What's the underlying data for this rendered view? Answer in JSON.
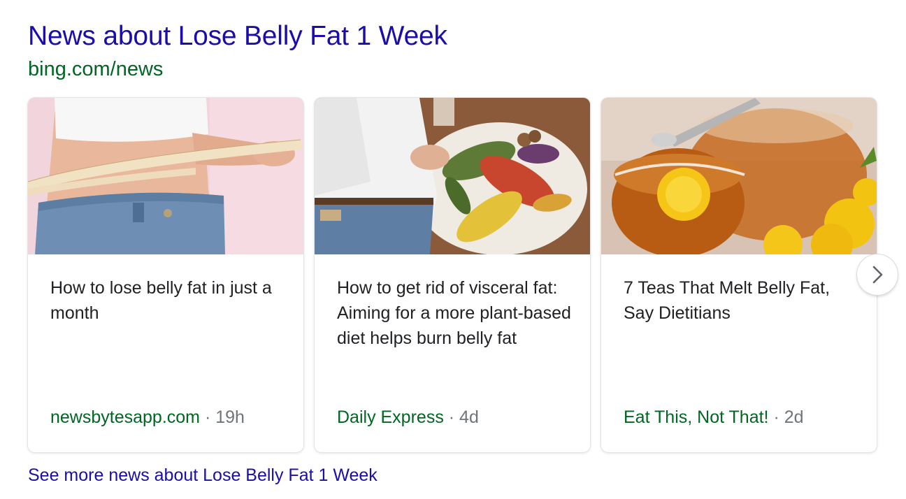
{
  "header": {
    "title": "News about Lose Belly Fat 1 Week",
    "url": "bing.com/news"
  },
  "cards": [
    {
      "headline": "How to lose belly fat in just a month",
      "publisher": "newsbytesapp.com",
      "separator": " · ",
      "age": "19h",
      "image": "woman measuring waist with tape measure"
    },
    {
      "headline": "How to get rid of visceral fat: Aiming for a more plant-based diet helps burn belly fat",
      "publisher": "Daily Express",
      "separator": " · ",
      "age": "4d",
      "image": "man holding belly beside platter of grilled vegetables"
    },
    {
      "headline": "7 Teas That Melt Belly Fat, Say Dietitians",
      "publisher": "Eat This, Not That!",
      "separator": " · ",
      "age": "2d",
      "image": "glass cups of tea with dandelion flowers"
    }
  ],
  "carousel": {
    "next_icon": "chevron-right-icon"
  },
  "footer": {
    "see_more": "See more news about Lose Belly Fat 1 Week"
  },
  "colors": {
    "link": "#1a0dab",
    "url": "#006621",
    "publisher": "#006621",
    "meta": "#70757a",
    "headline": "#202124"
  }
}
